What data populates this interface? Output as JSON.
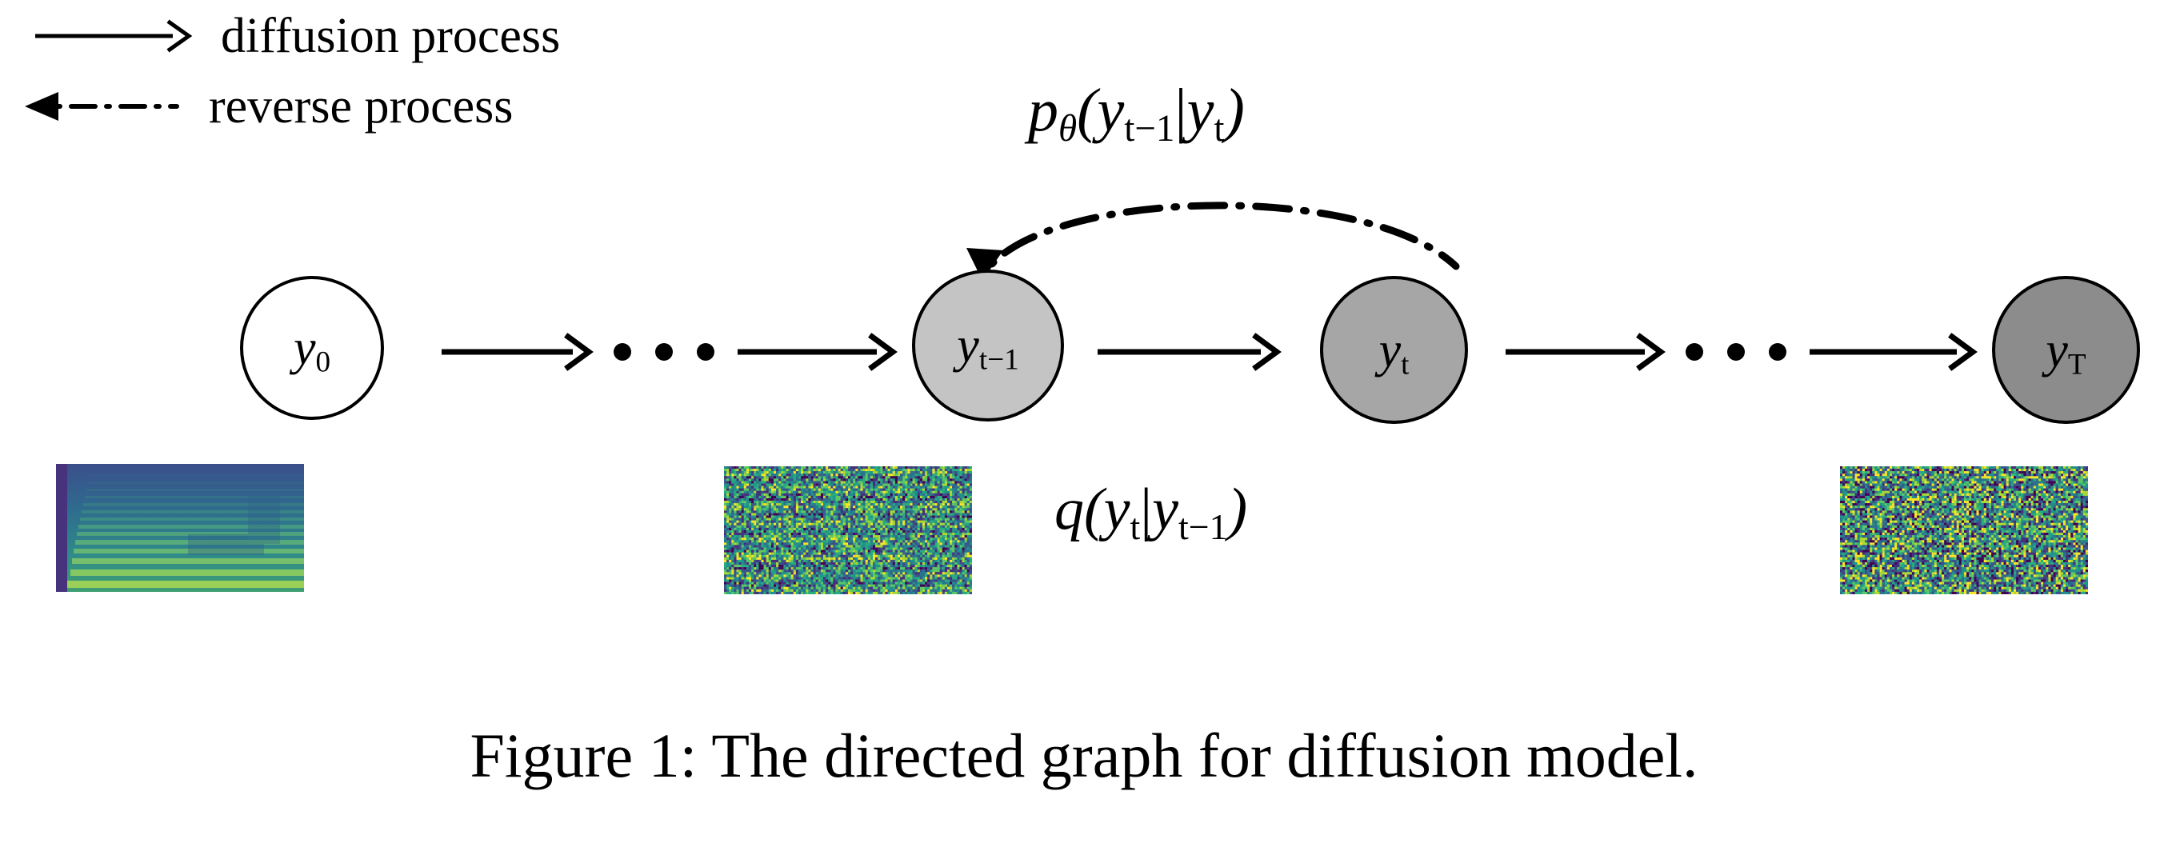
{
  "figure": {
    "caption": "Figure 1: The directed graph for diffusion model.",
    "background_color": "#ffffff",
    "ink_color": "#000000"
  },
  "legend": {
    "items": [
      {
        "id": "diffusion",
        "label": "diffusion process",
        "line_style": "solid",
        "arrow_direction": "right",
        "icon": "solid-arrow-right-icon"
      },
      {
        "id": "reverse",
        "label": "reverse process",
        "line_style": "dash-dot",
        "arrow_direction": "left",
        "icon": "dashdot-arrow-left-icon"
      }
    ]
  },
  "equations": {
    "reverse": {
      "id": "p-theta",
      "text": "pθ(yt−1|yt)",
      "parts": {
        "fn": "p",
        "param": "θ",
        "lhs": "y",
        "lhs_sub": "t−1",
        "bar": "|",
        "rhs": "y",
        "rhs_sub": "t"
      }
    },
    "forward": {
      "id": "q",
      "text": "q(yt|yt−1)",
      "parts": {
        "fn": "q",
        "lhs": "y",
        "lhs_sub": "t",
        "bar": "|",
        "rhs": "y",
        "rhs_sub": "t−1"
      }
    }
  },
  "nodes": [
    {
      "id": "y0",
      "var": "y",
      "sub": "0",
      "fill": "#ffffff",
      "stroke": "#000000"
    },
    {
      "id": "yt-1",
      "var": "y",
      "sub": "t−1",
      "fill": "#c4c4c4",
      "stroke": "#000000"
    },
    {
      "id": "yt",
      "var": "y",
      "sub": "t",
      "fill": "#a6a6a6",
      "stroke": "#000000"
    },
    {
      "id": "yT",
      "var": "y",
      "sub": "T",
      "fill": "#8c8c8c",
      "stroke": "#000000"
    }
  ],
  "ellipses": [
    {
      "id": "ellipsis-left",
      "dots": 3
    },
    {
      "id": "ellipsis-right",
      "dots": 3
    }
  ],
  "spectrograms": [
    {
      "id": "spectro-y0",
      "noise_level": 0.0,
      "description": "clean mel spectrogram with harmonic bands",
      "colormap": "viridis"
    },
    {
      "id": "spectro-yt-1",
      "noise_level": 0.75,
      "description": "noisy mel spectrogram",
      "colormap": "viridis"
    },
    {
      "id": "spectro-yT",
      "noise_level": 1.0,
      "description": "pure gaussian noise spectrogram",
      "colormap": "viridis"
    }
  ],
  "chart_data": {
    "type": "diagram",
    "title": "The directed graph for diffusion model.",
    "graph_nodes": [
      "y0",
      "yt-1",
      "yt",
      "yT"
    ],
    "forward_edges": [
      {
        "from": "y0",
        "to": "ellipsis-left",
        "style": "solid"
      },
      {
        "from": "ellipsis-left",
        "to": "yt-1",
        "style": "solid"
      },
      {
        "from": "yt-1",
        "to": "yt",
        "style": "solid",
        "label": "q(yt|yt−1)"
      },
      {
        "from": "yt",
        "to": "ellipsis-right",
        "style": "solid"
      },
      {
        "from": "ellipsis-right",
        "to": "yT",
        "style": "solid"
      }
    ],
    "reverse_edges": [
      {
        "from": "yt",
        "to": "yt-1",
        "style": "dash-dot",
        "curved": true,
        "label": "pθ(yt−1|yt)"
      }
    ]
  }
}
